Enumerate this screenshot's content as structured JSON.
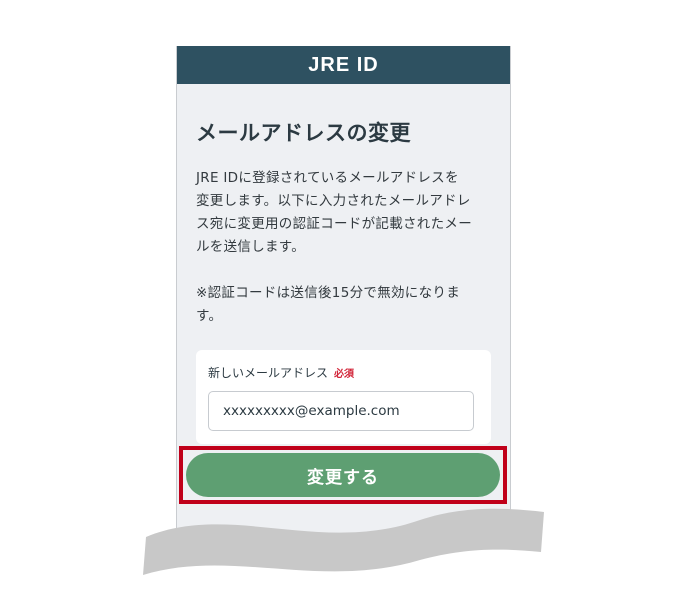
{
  "header": {
    "brand": "JRE ID"
  },
  "main": {
    "title": "メールアドレスの変更",
    "description_lines": [
      "JRE IDに登録されているメールアドレスを",
      "変更します。以下に入力されたメールアドレ",
      "ス宛に変更用の認証コードが記載されたメー",
      "ルを送信します。"
    ],
    "note_lines": [
      "※認証コードは送信後15分で無効になりま",
      "す。"
    ]
  },
  "form": {
    "email_label": "新しいメールアドレス",
    "required_label": "必須",
    "email_value": "xxxxxxxxx@example.com"
  },
  "actions": {
    "submit_label": "変更する"
  },
  "colors": {
    "header_bg": "#2e5161",
    "button_bg": "#5e9f72",
    "highlight": "#c0001a",
    "required": "#d2263a"
  }
}
